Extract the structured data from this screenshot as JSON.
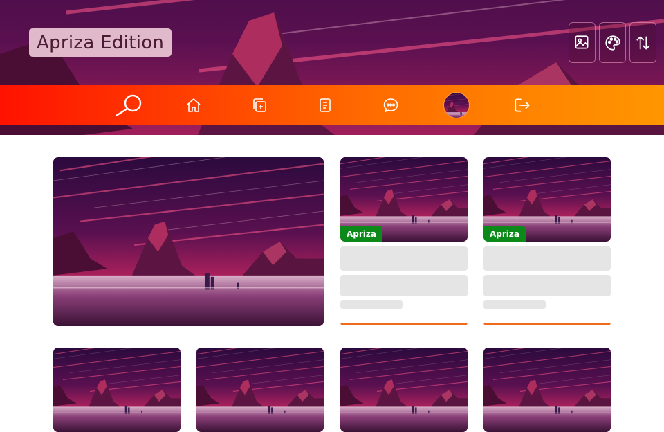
{
  "header": {
    "brand_label": "Apriza Edition",
    "tools": [
      {
        "icon": "image-icon"
      },
      {
        "icon": "palette-icon"
      },
      {
        "icon": "sort-arrows-icon"
      }
    ]
  },
  "nav": {
    "items": [
      {
        "icon": "search-icon"
      },
      {
        "icon": "home-icon"
      },
      {
        "icon": "add-copy-icon"
      },
      {
        "icon": "document-icon"
      },
      {
        "icon": "chat-bubble-icon"
      },
      {
        "icon": "avatar"
      },
      {
        "icon": "logout-icon"
      }
    ],
    "gradient": [
      "#ff1200",
      "#ff9600"
    ]
  },
  "cards": {
    "tag_label": "Apriza",
    "tag_color": "#0b8a19",
    "accent_color": "#f06a1c",
    "loading_placeholder_color": "#e5e5e5"
  }
}
